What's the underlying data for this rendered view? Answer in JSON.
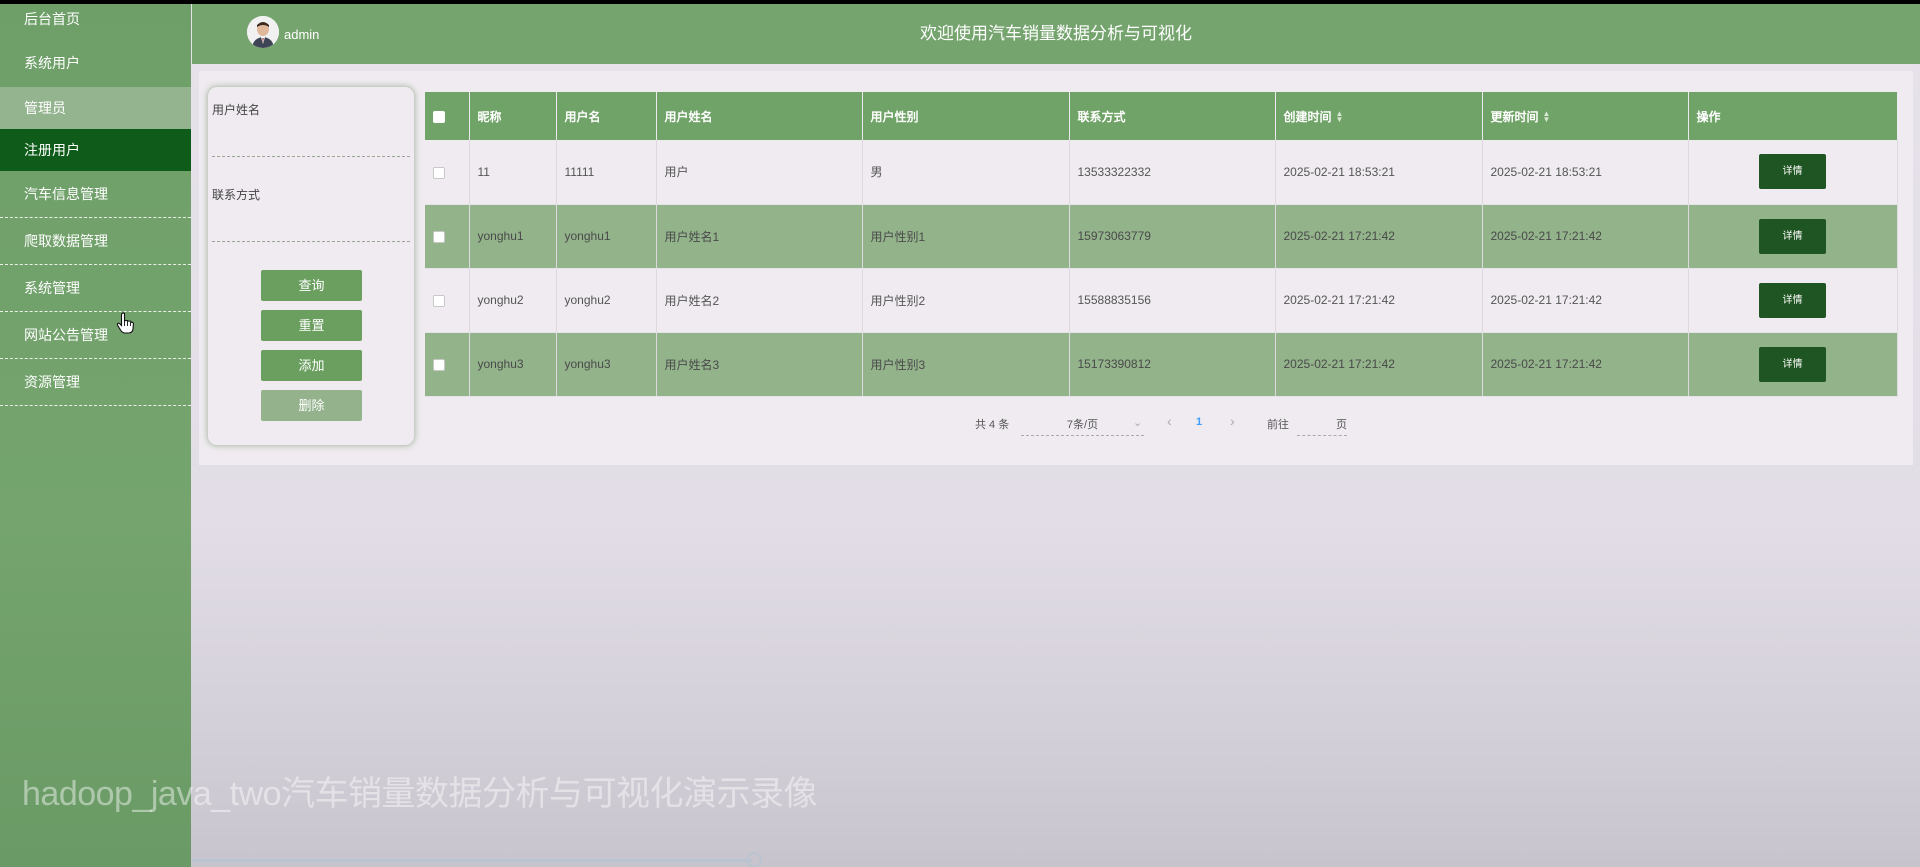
{
  "sidebar": {
    "items": [
      {
        "label": "后台首页"
      },
      {
        "label": "系统用户"
      },
      {
        "label": "管理员"
      },
      {
        "label": "注册用户"
      },
      {
        "label": "汽车信息管理"
      },
      {
        "label": "爬取数据管理"
      },
      {
        "label": "系统管理"
      },
      {
        "label": "网站公告管理"
      },
      {
        "label": "资源管理"
      }
    ],
    "active_item": "注册用户"
  },
  "header": {
    "user": "admin",
    "title": "欢迎使用汽车销量数据分析与可视化"
  },
  "search": {
    "field1_label": "用户姓名",
    "field1_value": "",
    "field2_label": "联系方式",
    "field2_value": "",
    "query_label": "查询",
    "reset_label": "重置",
    "add_label": "添加",
    "delete_label": "删除"
  },
  "table": {
    "columns": [
      "昵称",
      "用户名",
      "用户姓名",
      "用户性别",
      "联系方式",
      "创建时间",
      "更新时间",
      "操作"
    ],
    "rows": [
      {
        "nickname": "11",
        "username": "11111",
        "name": "用户",
        "gender": "男",
        "phone": "13533322332",
        "created": "2025-02-21 18:53:21",
        "updated": "2025-02-21 18:53:21",
        "action": "详情"
      },
      {
        "nickname": "yonghu1",
        "username": "yonghu1",
        "name": "用户姓名1",
        "gender": "用户性别1",
        "phone": "15973063779",
        "created": "2025-02-21 17:21:42",
        "updated": "2025-02-21 17:21:42",
        "action": "详情"
      },
      {
        "nickname": "yonghu2",
        "username": "yonghu2",
        "name": "用户姓名2",
        "gender": "用户性别2",
        "phone": "15588835156",
        "created": "2025-02-21 17:21:42",
        "updated": "2025-02-21 17:21:42",
        "action": "详情"
      },
      {
        "nickname": "yonghu3",
        "username": "yonghu3",
        "name": "用户姓名3",
        "gender": "用户性别3",
        "phone": "15173390812",
        "created": "2025-02-21 17:21:42",
        "updated": "2025-02-21 17:21:42",
        "action": "详情"
      }
    ]
  },
  "pagination": {
    "total": "共 4 条",
    "page_size": "7条/页",
    "prev": "‹",
    "current_page": "1",
    "next": "›",
    "goto_prefix": "前往",
    "goto_suffix": "页"
  },
  "watermark": "hadoop_java_two汽车销量数据分析与可视化演示录像",
  "colors": {
    "sidebar": "#75a46e",
    "active": "#0f5b19",
    "header": "#75a46e",
    "table_header": "#70a367",
    "row_alt": "#93b38b",
    "detail_button": "#1f5522",
    "pager_current": "#409eff"
  },
  "icons": {
    "sort": "sort-icon",
    "checkbox": "checkbox-icon",
    "cursor": "hand-pointer-icon"
  }
}
